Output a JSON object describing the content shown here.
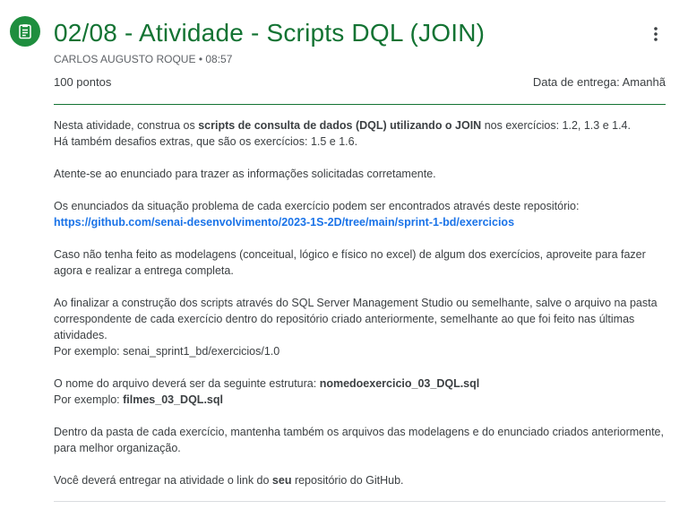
{
  "header": {
    "icon": "assignment-icon",
    "title": "02/08 - Atividade - Scripts DQL (JOIN)",
    "author": "CARLOS AUGUSTO ROQUE",
    "separator": "•",
    "time": "08:57",
    "more_icon": "more-vert-icon"
  },
  "info": {
    "points": "100 pontos",
    "due": "Data de entrega: Amanhã"
  },
  "colors": {
    "accent": "#137333",
    "icon_bg": "#1e8e3e",
    "link": "#1a73e8"
  },
  "body": {
    "p1_a": "Nesta atividade, construa os ",
    "p1_b": "scripts de consulta de dados (DQL) utilizando o JOIN",
    "p1_c": " nos exercícios: 1.2, 1.3 e 1.4.",
    "p1_d": "Há também desafios extras, que são os exercícios: 1.5 e 1.6.",
    "p2": "Atente-se ao enunciado para trazer as informações solicitadas corretamente.",
    "p3_a": "Os enunciados da situação problema de cada exercício podem ser encontrados através deste repositório:",
    "p3_link": "https://github.com/senai-desenvolvimento/2023-1S-2D/tree/main/sprint-1-bd/exercicios",
    "p4": "Caso não tenha feito as modelagens (conceitual, lógico e físico no excel) de algum dos exercícios, aproveite para fazer agora e realizar a entrega completa.",
    "p5_a": "Ao finalizar a construção dos scripts através do SQL Server Management Studio ou semelhante, salve o arquivo na pasta correspondente de cada exercício dentro do repositório criado anteriormente, semelhante ao que foi feito nas últimas atividades.",
    "p5_b": "Por exemplo: senai_sprint1_bd/exercicios/1.0",
    "p6_a": "O nome do arquivo deverá ser da seguinte estrutura: ",
    "p6_b": "nomedoexercicio_03_DQL.sql",
    "p6_c": "Por exemplo: ",
    "p6_d": "filmes_03_DQL.sql",
    "p7": "Dentro da pasta de cada exercício, mantenha também os arquivos das modelagens e do enunciado criados anteriormente, para melhor organização.",
    "p8_a": "Você deverá entregar na atividade o link do ",
    "p8_b": "seu",
    "p8_c": " repositório do GitHub."
  }
}
